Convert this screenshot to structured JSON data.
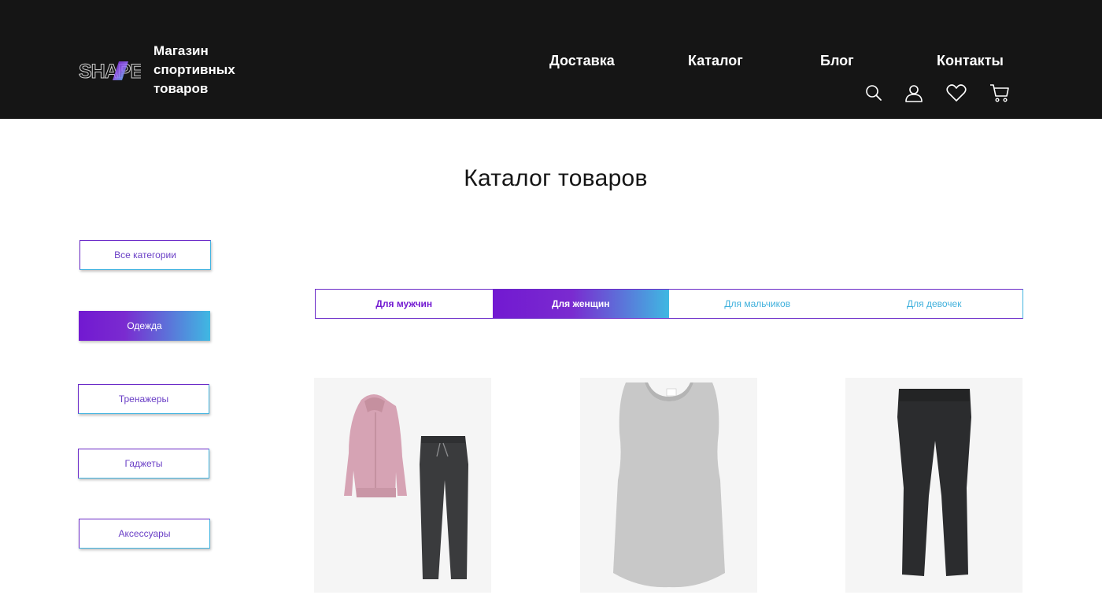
{
  "header": {
    "logo_text": "SHAPE",
    "brand_lines": [
      "Магазин",
      "спортивных",
      "товаров"
    ],
    "nav": [
      "Доставка",
      "Каталог",
      "Блог",
      "Контакты"
    ],
    "icons": [
      "search-icon",
      "user-icon",
      "heart-icon",
      "cart-icon"
    ]
  },
  "main": {
    "title": "Каталог товаров"
  },
  "sidebar": {
    "categories": [
      {
        "label": "Все категории",
        "active": false
      },
      {
        "label": "Одежда",
        "active": true
      },
      {
        "label": "Тренажеры",
        "active": false
      },
      {
        "label": "Гаджеты",
        "active": false
      },
      {
        "label": "Аксессуары",
        "active": false
      }
    ]
  },
  "tabs": [
    {
      "label": "Для мужчин",
      "active": false
    },
    {
      "label": "Для женщин",
      "active": true
    },
    {
      "label": "Для мальчиков",
      "active": false
    },
    {
      "label": "Для девочек",
      "active": false
    }
  ],
  "products": [
    {
      "image": "pink-hoodie-and-dark-joggers"
    },
    {
      "image": "grey-tank-top"
    },
    {
      "image": "black-capri-leggings"
    }
  ],
  "colors": {
    "header_bg": "#151515",
    "accent_purple": "#7219d1",
    "accent_blue": "#3fb8e2"
  }
}
